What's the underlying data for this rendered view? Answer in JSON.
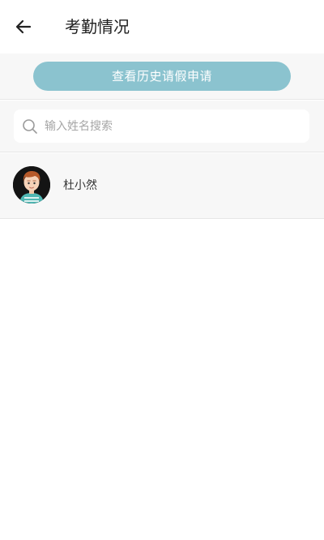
{
  "header": {
    "title": "考勤情况",
    "back_icon": "arrow-left-icon"
  },
  "history": {
    "button_label": "查看历史请假申请"
  },
  "search": {
    "placeholder": "输入姓名搜索",
    "value": "",
    "icon": "search-icon"
  },
  "people": [
    {
      "name": "杜小然",
      "avatar_icon": "avatar-cartoon-boy"
    }
  ],
  "colors": {
    "accent": "#8bc3cf",
    "section_bg": "#f7f7f7",
    "divider": "#e6e6e6",
    "title_text": "#1f1f1f",
    "placeholder_text": "#a6a6a6"
  }
}
